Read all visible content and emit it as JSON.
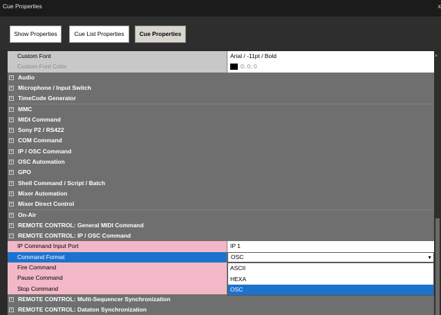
{
  "window": {
    "title": "Cue Properties",
    "close_label": "x"
  },
  "toolbar": {
    "show_properties": "Show Properties",
    "cue_list_properties": "Cue List Properties",
    "cue_properties": "Cue Properties"
  },
  "top_props": [
    {
      "name": "Custom Font",
      "value": "Arial / -11pt / Bold"
    },
    {
      "name": "Custom Font Color",
      "value": "0; 0; 0"
    }
  ],
  "categories": [
    "Audio",
    "Microphone / Input Switch",
    "TimeCode Generator",
    "MMC",
    "MIDI Command",
    "Sony P2 / RS422",
    "COM Command",
    "IP / OSC Command",
    "OSC Automation",
    "GPO",
    "Shell Command / Script / Batch",
    "Mixer Automation",
    "Mixer Direct Control",
    "On-Air",
    "REMOTE CONTROL: General MIDI Command",
    "REMOTE CONTROL: IP / OSC Command"
  ],
  "expand_glyph": "+",
  "collapse_glyph": "−",
  "remote_props": [
    {
      "name": "IP Command Input Port",
      "value": "IP 1"
    },
    {
      "name": "Command Format",
      "value": "OSC"
    },
    {
      "name": "Fire Command",
      "value": ""
    },
    {
      "name": "Pause Command",
      "value": ""
    },
    {
      "name": "Stop Command",
      "value": ""
    }
  ],
  "format_options": [
    "ASCII",
    "HEXA",
    "OSC"
  ],
  "selected_format": "OSC",
  "bottom_categories": [
    "REMOTE CONTROL: Multi-Sequencer Synchronization",
    "REMOTE CONTROL: Dataton Synchronization"
  ],
  "icons": {
    "expand": "plus-box-icon",
    "collapse": "minus-box-icon",
    "dropdown": "chevron-down-icon"
  },
  "colors": {
    "selection": "#1c73cd",
    "pink": "#f2b8c7",
    "category": "#6f6f6f"
  }
}
